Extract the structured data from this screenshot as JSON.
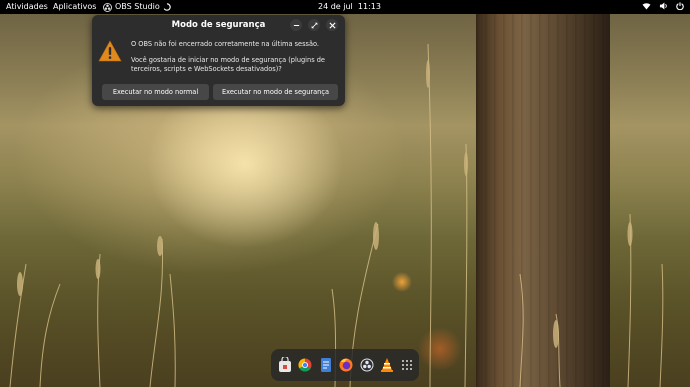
{
  "topbar": {
    "activities": "Atividades",
    "applications": "Aplicativos",
    "app_name": "OBS Studio",
    "clock": "24 de jul  11:13",
    "status_icons": [
      "wifi-icon",
      "volume-icon",
      "power-icon"
    ]
  },
  "dialog": {
    "title": "Modo de segurança",
    "message_line1": "O OBS não foi encerrado corretamente na última sessão.",
    "message_line2": "Você gostaria de iniciar no modo de segurança (plugins de terceiros, scripts e WebSockets desativados)?",
    "button_normal": "Executar no modo normal",
    "button_safe": "Executar no modo de segurança",
    "controls": [
      "minimize-icon",
      "maximize-icon",
      "close-icon"
    ]
  },
  "dock": {
    "apps": [
      "software-center-icon",
      "chrome-icon",
      "text-editor-icon",
      "firefox-icon",
      "obs-icon",
      "vlc-icon",
      "app-grid-icon"
    ]
  },
  "colors": {
    "topbar_bg": "#000000",
    "dialog_bg": "#2d2d2d",
    "button_bg": "#474747",
    "warning": "#e08a1e"
  }
}
